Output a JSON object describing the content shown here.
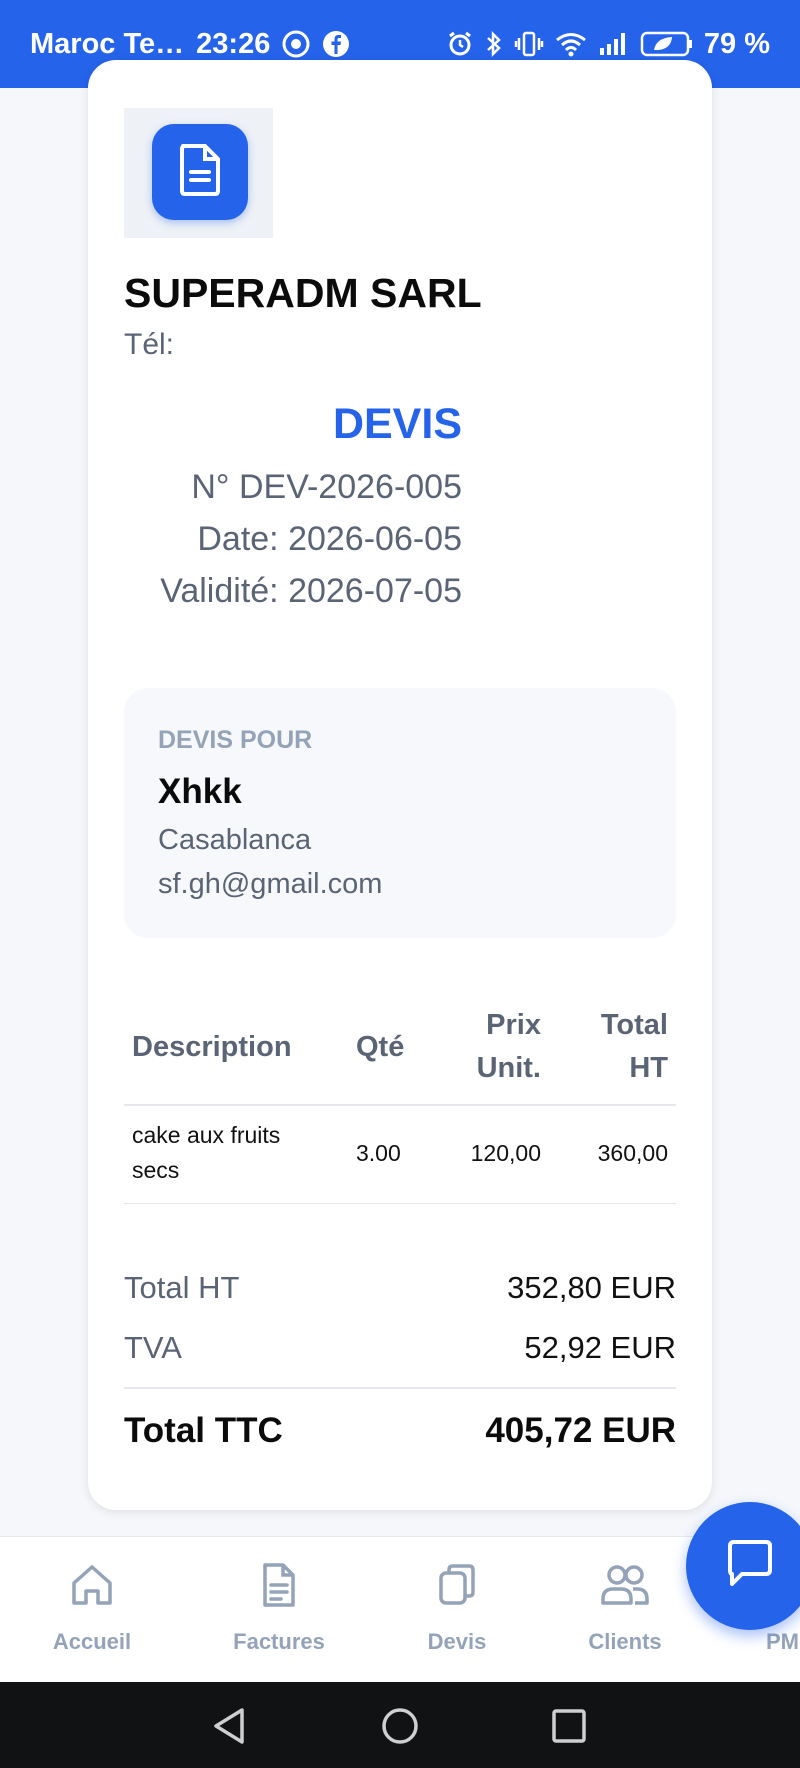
{
  "status_bar": {
    "carrier": "Maroc Te…",
    "time": "23:26",
    "battery": "79 %"
  },
  "header": {
    "company_name": "SUPERADM SARL",
    "tel_label": "Tél:"
  },
  "document": {
    "title": "DEVIS",
    "number": "N° DEV-2026-005",
    "date": "Date: 2026-06-05",
    "validity": "Validité: 2026-07-05"
  },
  "client": {
    "label": "DEVIS POUR",
    "name": "Xhkk",
    "city": "Casablanca",
    "email": "sf.gh@gmail.com"
  },
  "table": {
    "headers": {
      "description": "Description",
      "qty": "Qté",
      "unit_price_1": "Prix",
      "unit_price_2": "Unit.",
      "total_ht_1": "Total",
      "total_ht_2": "HT"
    },
    "rows": [
      {
        "description_1": "cake aux fruits",
        "description_2": "secs",
        "qty": "3.00",
        "unit_price": "120,00",
        "total": "360,00"
      }
    ]
  },
  "totals": {
    "ht_label": "Total HT",
    "ht_value": "352,80 EUR",
    "tva_label": "TVA",
    "tva_value": "52,92 EUR",
    "ttc_label": "Total TTC",
    "ttc_value": "405,72 EUR"
  },
  "bottom_nav": {
    "items": [
      {
        "label": "Accueil",
        "icon": "home-icon"
      },
      {
        "label": "Factures",
        "icon": "file-text-icon"
      },
      {
        "label": "Devis",
        "icon": "copy-icon"
      },
      {
        "label": "Clients",
        "icon": "users-icon"
      },
      {
        "label": "PM",
        "icon": "none"
      }
    ]
  },
  "colors": {
    "accent": "#2563eb",
    "muted": "#5b6475",
    "label": "#94a3b8"
  }
}
